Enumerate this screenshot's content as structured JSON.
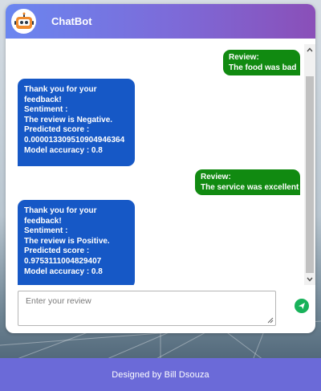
{
  "header": {
    "title": "ChatBot",
    "avatar_icon": "robot-icon"
  },
  "messages": [
    {
      "sender": "user",
      "lines": [
        "Review:",
        "The food was bad"
      ]
    },
    {
      "sender": "bot",
      "lines": [
        "Thank you for your",
        "feedback!",
        "Sentiment :",
        "The review is Negative.",
        "Predicted score :",
        "0.000013309510904946364",
        "Model accuracy : 0.8"
      ]
    },
    {
      "sender": "user",
      "lines": [
        "Review:",
        "The service was excellent"
      ]
    },
    {
      "sender": "bot",
      "lines": [
        "Thank you for your",
        "feedback!",
        "Sentiment :",
        "The review is Positive.",
        "Predicted score :",
        "0.9753111004829407",
        "Model accuracy : 0.8"
      ]
    }
  ],
  "input": {
    "placeholder": "Enter your review",
    "value": ""
  },
  "send": {
    "icon": "send-icon"
  },
  "footer": {
    "text": "Designed by Bill Dsouza"
  },
  "colors": {
    "header_gradient_start": "#6a86f0",
    "header_gradient_end": "#8a4fb8",
    "user_bubble": "#118a11",
    "bot_bubble": "#1658c6",
    "send_button": "#18b25a",
    "footer": "#6b6ad8"
  }
}
